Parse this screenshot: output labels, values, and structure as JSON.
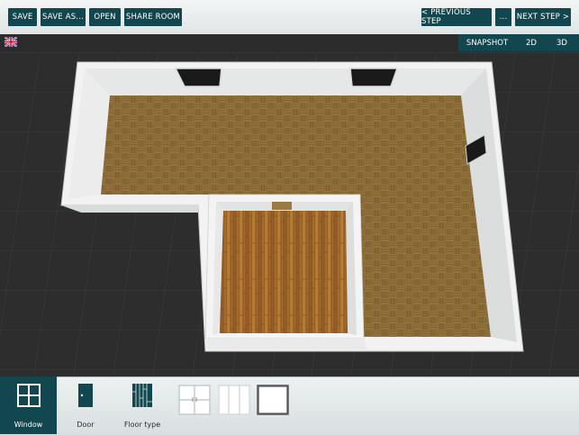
{
  "toolbar": {
    "save": "SAVE",
    "save_as": "SAVE AS...",
    "open": "OPEN",
    "share_room": "SHARE ROOM",
    "previous_step": "< PREVIOUS STEP",
    "more": "...",
    "next_step": "NEXT STEP >"
  },
  "view": {
    "snapshot": "SNAPSHOT",
    "mode_2d": "2D",
    "mode_3d": "3D"
  },
  "language": {
    "flag_icon": "uk-flag-icon"
  },
  "tools": [
    {
      "label": "Window",
      "icon": "window-icon",
      "active": true
    },
    {
      "label": "Door",
      "icon": "door-icon",
      "active": false
    },
    {
      "label": "Floor type",
      "icon": "floor-type-icon",
      "active": false
    }
  ],
  "window_options": [
    {
      "icon": "double-window-icon",
      "selected": false
    },
    {
      "icon": "triple-window-icon",
      "selected": false
    },
    {
      "icon": "single-window-icon",
      "selected": true
    }
  ],
  "colors": {
    "accent": "#13474f",
    "floor_parquet": "#8a6a36",
    "floor_plank": "#a36b2c",
    "wall": "#f2f2f2"
  }
}
